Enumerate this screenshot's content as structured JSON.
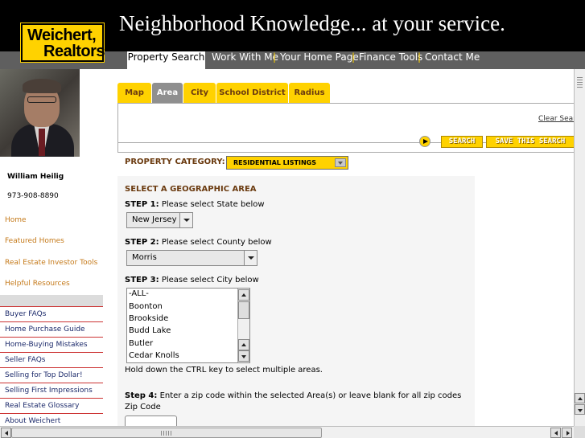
{
  "brand": {
    "line1": "Weichert,",
    "line2": "Realtors",
    "accent_color": "#ffd200"
  },
  "header": {
    "tagline": "Neighborhood Knowledge... at your service."
  },
  "nav": {
    "items": [
      "Property Search",
      "Work With Me",
      "Your Home Page",
      "Finance Tools",
      "Contact Me"
    ],
    "separator": "|",
    "active": "Property Search"
  },
  "agent": {
    "name": "William Heilig",
    "phone": "973-908-8890"
  },
  "sidebar": {
    "links": [
      "Home",
      "Featured Homes",
      "Real Estate Investor Tools",
      "Helpful Resources"
    ],
    "faq": [
      "Buyer FAQs",
      "Home Purchase Guide",
      "Home-Buying Mistakes",
      "Seller FAQs",
      "Selling for Top Dollar!",
      "Selling First Impressions",
      "Real Estate Glossary",
      "About Weichert"
    ]
  },
  "tabs": {
    "items": [
      "Map",
      "Area",
      "City",
      "School District",
      "Radius"
    ],
    "active": "Area"
  },
  "search": {
    "clear_label": "Clear Sear",
    "search_button": "SEARCH",
    "save_button": "SAVE THIS SEARCH",
    "category_label": "PROPERTY CATEGORY:",
    "category_value": "RESIDENTIAL LISTINGS"
  },
  "geo": {
    "title": "SELECT A GEOGRAPHIC AREA",
    "step1_label": "STEP 1:",
    "step1_text": "Please select State below",
    "state_value": "New Jersey",
    "step2_label": "STEP 2:",
    "step2_text": "Please select County below",
    "county_value": "Morris",
    "step3_label": "STEP 3:",
    "step3_text": "Please select City below",
    "cities": [
      "-ALL-",
      "Boonton",
      "Brookside",
      "Budd Lake",
      "Butler",
      "Cedar Knolls"
    ],
    "hint": "Hold down the CTRL key to select multiple areas.",
    "step4_label": "Step 4:",
    "step4_text": "Enter a zip code within the selected Area(s) or leave blank for all zip codes",
    "zip_label": "Zip Code",
    "zip_value": ""
  }
}
